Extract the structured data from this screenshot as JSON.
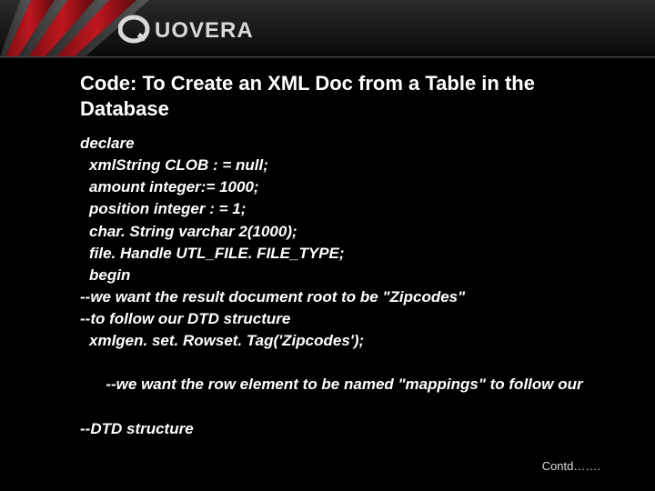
{
  "logo": {
    "brand": "QUOVERA"
  },
  "title": "Code: To Create an XML Doc from a Table in the Database",
  "code": {
    "l0": "declare",
    "l1": "xmlString CLOB : = null;",
    "l2": "amount integer:= 1000;",
    "l3": "position integer : = 1;",
    "l4": "char. String varchar 2(1000);",
    "l5": "file. Handle UTL_FILE. FILE_TYPE;",
    "l6": "begin",
    "l7": "--we want the result document root to be \"Zipcodes\"",
    "l8": "--to follow our DTD structure",
    "l9": "xmlgen. set. Rowset. Tag('Zipcodes');",
    "l10": "--we want the row element to be named \"mappings\" to follow our",
    "l11": "--DTD structure"
  },
  "footer": {
    "contd": "Contd……."
  },
  "colors": {
    "accent_red": "#b3131a",
    "bg": "#000000"
  }
}
